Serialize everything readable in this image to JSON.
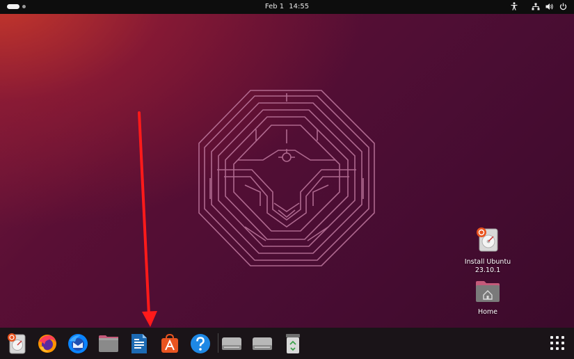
{
  "topbar": {
    "date": "Feb 1",
    "time": "14:55"
  },
  "tray_icons": [
    "accessibility-icon",
    "network-icon",
    "volume-icon",
    "power-icon"
  ],
  "desktop_icons": [
    {
      "label_line1": "Install Ubuntu",
      "label_line2": "23.10.1",
      "icon": "installer-icon"
    },
    {
      "label_line1": "Home",
      "icon": "home-folder-icon"
    }
  ],
  "dock": {
    "items": [
      {
        "name": "ubuntu-installer",
        "icon": "installer-icon"
      },
      {
        "name": "firefox",
        "icon": "firefox-icon"
      },
      {
        "name": "thunderbird",
        "icon": "thunderbird-icon"
      },
      {
        "name": "files",
        "icon": "files-icon"
      },
      {
        "name": "libreoffice-writer",
        "icon": "writer-icon"
      },
      {
        "name": "app-center",
        "icon": "app-center-icon"
      },
      {
        "name": "help",
        "icon": "help-icon"
      },
      {
        "name": "drive-1",
        "icon": "drive-icon"
      },
      {
        "name": "drive-2",
        "icon": "drive-icon"
      },
      {
        "name": "trash",
        "icon": "trash-icon"
      }
    ],
    "show_apps_icon": "app-grid-icon"
  },
  "colors": {
    "topbar": "#0d0d0d",
    "dock": "#1a1418",
    "wallpaper_dark": "#4a0d33",
    "annotation_arrow": "#ff1a1a",
    "ubuntu_orange": "#e95420"
  }
}
